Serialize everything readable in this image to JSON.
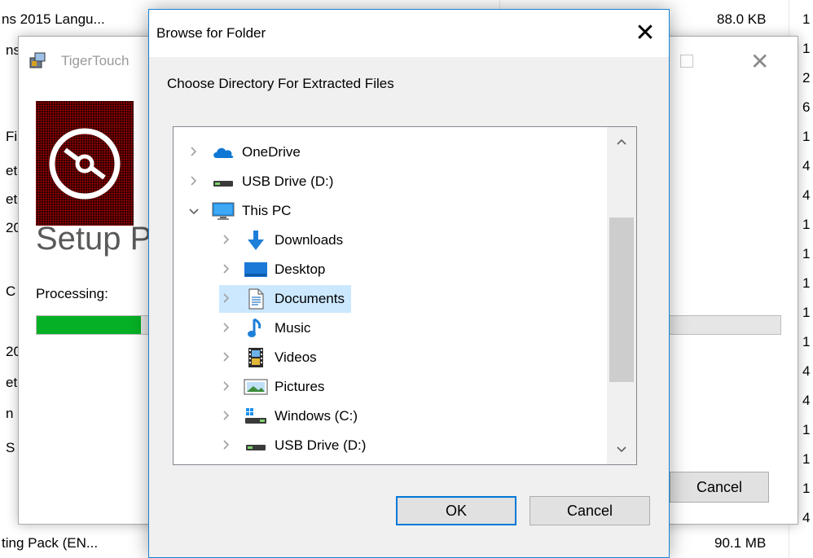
{
  "background": {
    "top_row": {
      "name": "ns 2015 Langu...",
      "size": "88.0 KB"
    },
    "bottom_row": {
      "name": "ting Pack (EN...",
      "size": "90.1 MB"
    },
    "left_fragments": [
      "ns",
      "Fi",
      "et",
      "et",
      "20",
      "C",
      "20",
      "et",
      "n",
      "S"
    ],
    "right_digits": [
      "1",
      "1",
      "2",
      "6",
      "1",
      "4",
      "4",
      "1",
      "1",
      "1",
      "1",
      "1",
      "4",
      "4",
      "1",
      "1",
      "1",
      "4"
    ]
  },
  "setup_window": {
    "title": "TigerTouch",
    "heading": "Setup P",
    "processing_label": "Processing:",
    "progress": 0.14,
    "cancel_label": "Cancel"
  },
  "dialog": {
    "title": "Browse for Folder",
    "close_glyph": "✕",
    "prompt": "Choose Directory For Extracted Files",
    "tree": [
      {
        "label": "OneDrive",
        "icon": "onedrive-icon",
        "level": 0,
        "expanded": false,
        "selected": false
      },
      {
        "label": "USB Drive (D:)",
        "icon": "usb-drive-icon",
        "level": 0,
        "expanded": false,
        "selected": false
      },
      {
        "label": "This PC",
        "icon": "this-pc-icon",
        "level": 0,
        "expanded": true,
        "selected": false
      },
      {
        "label": "Downloads",
        "icon": "downloads-icon",
        "level": 1,
        "expanded": false,
        "selected": false
      },
      {
        "label": "Desktop",
        "icon": "desktop-icon",
        "level": 1,
        "expanded": false,
        "selected": false
      },
      {
        "label": "Documents",
        "icon": "documents-icon",
        "level": 1,
        "expanded": false,
        "selected": true
      },
      {
        "label": "Music",
        "icon": "music-icon",
        "level": 1,
        "expanded": false,
        "selected": false
      },
      {
        "label": "Videos",
        "icon": "videos-icon",
        "level": 1,
        "expanded": false,
        "selected": false
      },
      {
        "label": "Pictures",
        "icon": "pictures-icon",
        "level": 1,
        "expanded": false,
        "selected": false
      },
      {
        "label": "Windows (C:)",
        "icon": "windows-drive-icon",
        "level": 1,
        "expanded": false,
        "selected": false
      },
      {
        "label": "USB Drive (D:)",
        "icon": "usb-drive-icon",
        "level": 1,
        "expanded": false,
        "selected": false
      }
    ],
    "ok_label": "OK",
    "cancel_label": "Cancel"
  },
  "colors": {
    "accent": "#0078d7",
    "selection": "#cce8ff",
    "progress": "#06b025"
  }
}
